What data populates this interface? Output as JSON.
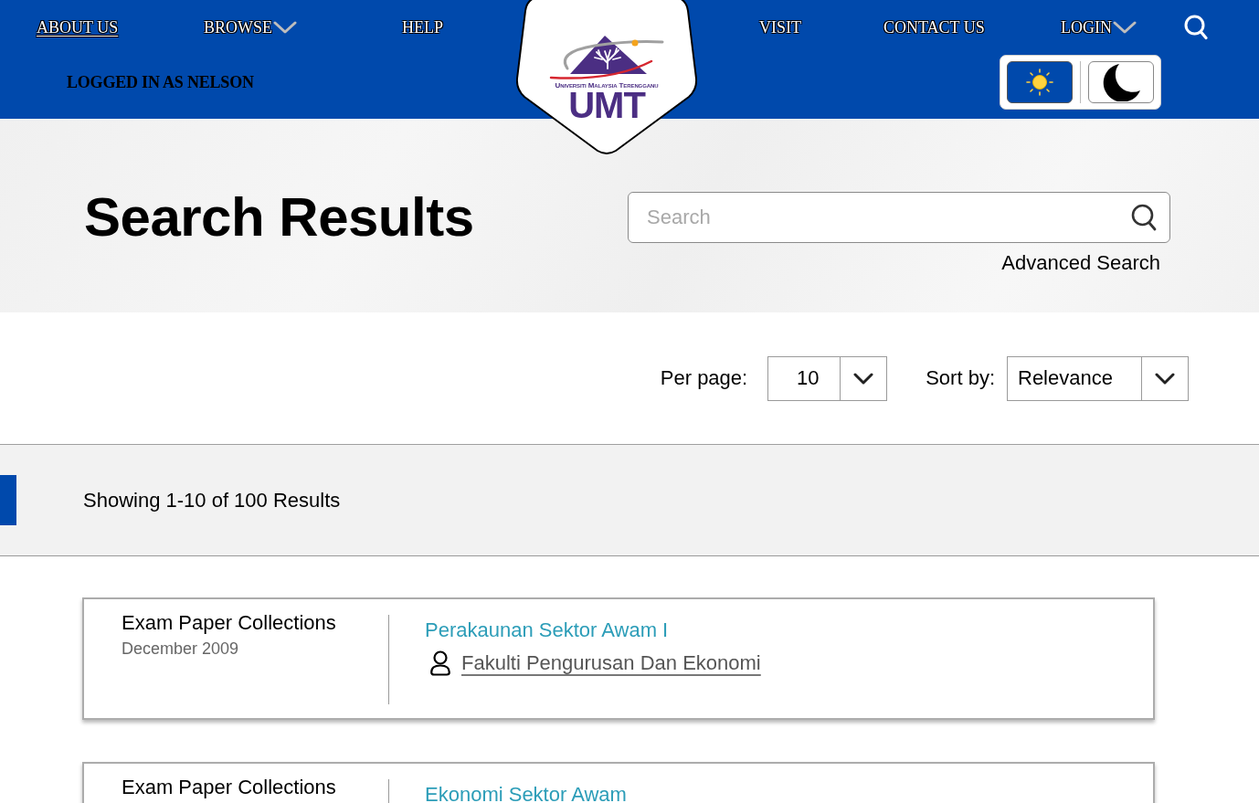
{
  "header": {
    "nav": [
      {
        "label": "ABOUT US",
        "selected": true,
        "dropdown": false
      },
      {
        "label": "BROWSE",
        "selected": false,
        "dropdown": true
      },
      {
        "label": "HELP",
        "selected": false,
        "dropdown": false
      },
      {
        "label": "VISIT",
        "selected": false,
        "dropdown": false
      },
      {
        "label": "CONTACT US",
        "selected": false,
        "dropdown": false
      },
      {
        "label": "LOGIN",
        "selected": false,
        "dropdown": true
      }
    ],
    "user_status": "LOGGED IN AS NELSON",
    "logo": {
      "caption": "Universiti Malaysia Terengganu",
      "wordmark": "UMT"
    },
    "theme_toggle": [
      {
        "kind": "light",
        "selected": true
      },
      {
        "kind": "dark",
        "selected": false
      }
    ]
  },
  "hero": {
    "title": "Search Results",
    "search": {
      "placeholder": "Search"
    },
    "advanced_search": "Advanced Search"
  },
  "controls": {
    "per_page": {
      "label": "Per page:",
      "value": "10"
    },
    "sort_by": {
      "label": "Sort by:",
      "value": "Relevance"
    }
  },
  "summary": "Showing 1-10 of 100 Results",
  "results": [
    {
      "collection": "Exam Paper Collections",
      "date": "December 2009",
      "title": "Perakaunan Sektor Awam I",
      "author": "Fakulti Pengurusan Dan Ekonomi"
    },
    {
      "collection": "Exam Paper Collections",
      "title": "Ekonomi Sektor Awam"
    }
  ]
}
